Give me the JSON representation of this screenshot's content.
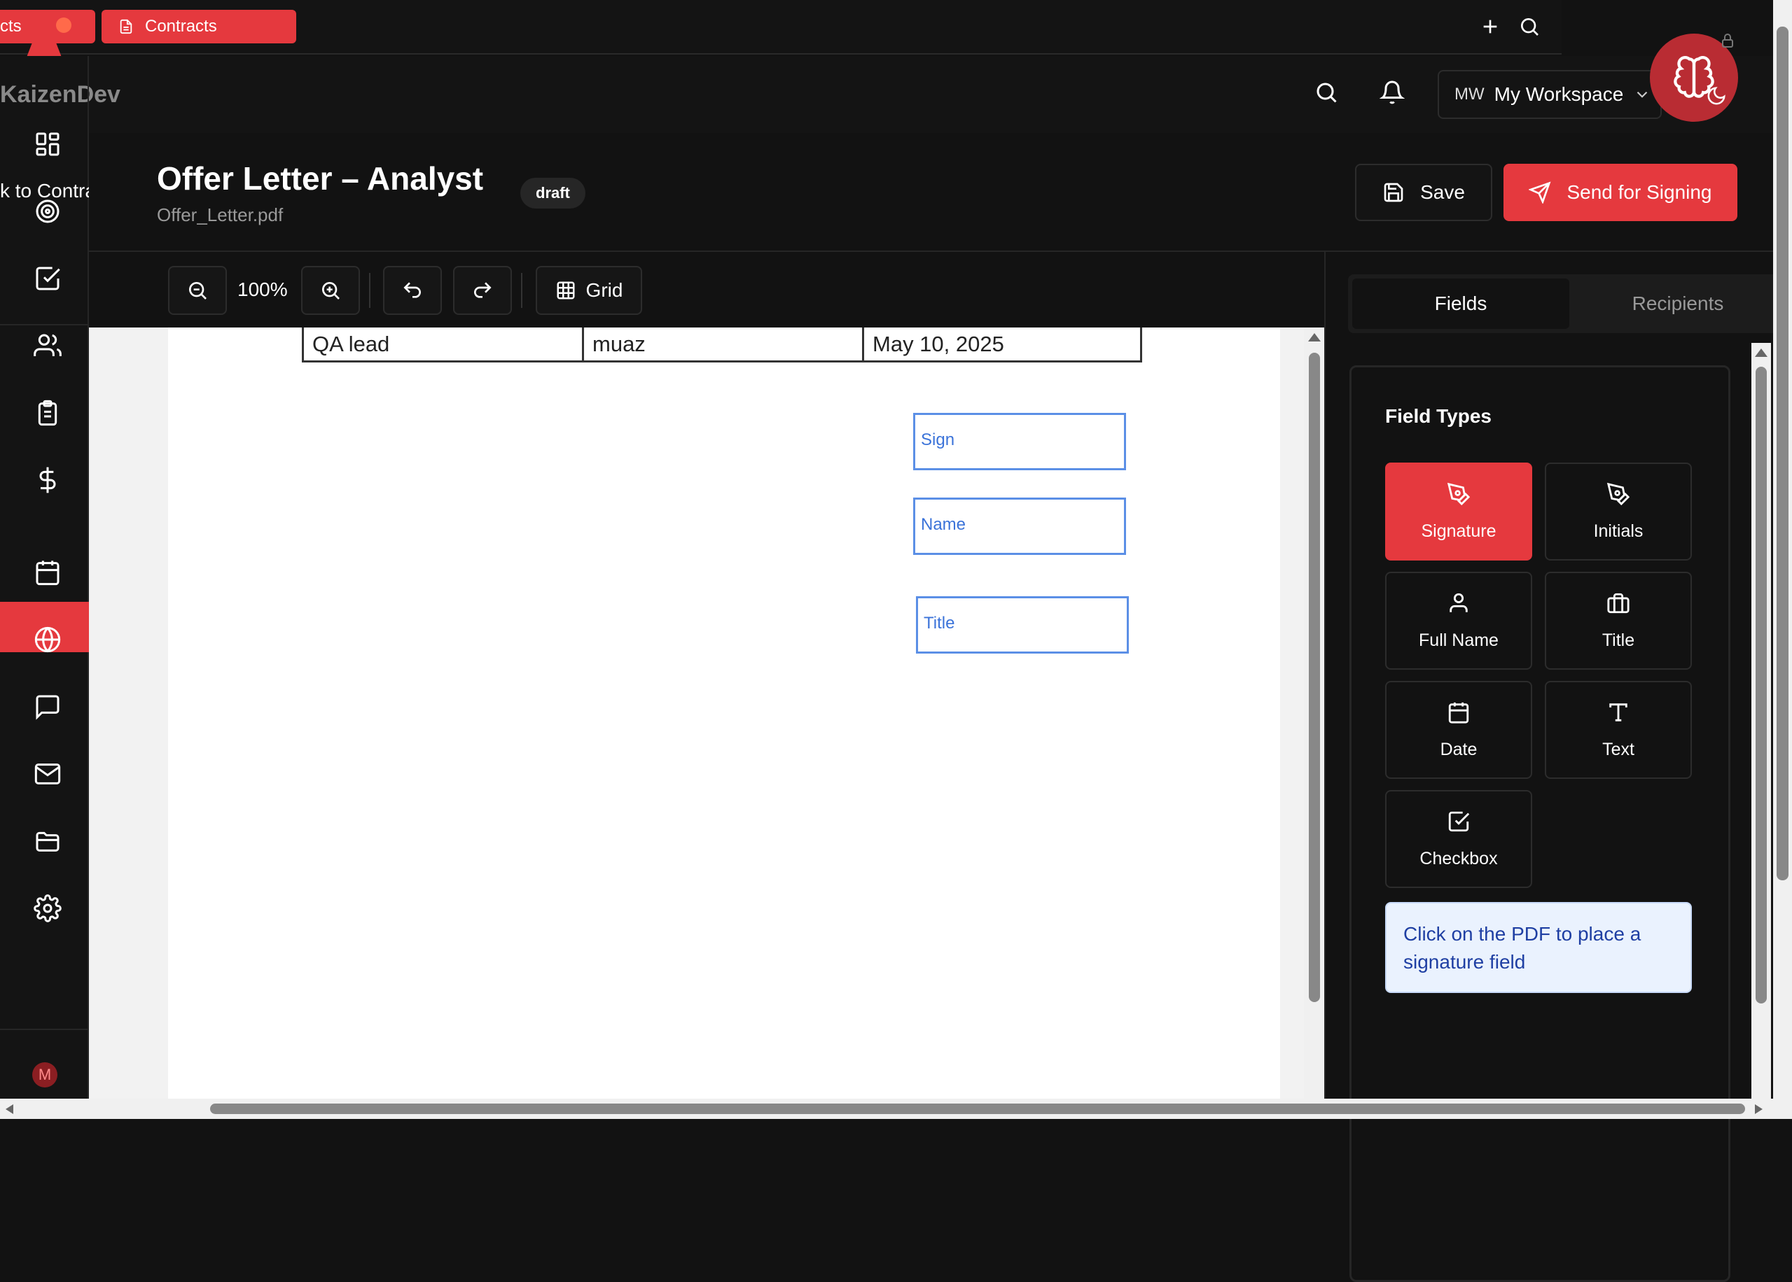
{
  "tabs": [
    {
      "label": "cts"
    },
    {
      "label": "Contracts"
    }
  ],
  "header": {
    "brand": "KaizenDev",
    "workspace_initials": "MW",
    "workspace_name": "My Workspace"
  },
  "sidebar": {
    "back_link": "k to Contracts",
    "avatar_initial": "M",
    "items": [
      {
        "icon": "dashboard-icon"
      },
      {
        "icon": "target-icon"
      },
      {
        "icon": "checkbox-icon"
      },
      {
        "icon": "users-icon"
      },
      {
        "icon": "clipboard-icon"
      },
      {
        "icon": "dollar-icon"
      },
      {
        "icon": "calendar-icon"
      },
      {
        "icon": "globe-icon"
      },
      {
        "icon": "chat-icon"
      },
      {
        "icon": "mail-icon"
      },
      {
        "icon": "folder-icon"
      },
      {
        "icon": "gear-icon"
      }
    ]
  },
  "document": {
    "title": "Offer Letter – Analyst",
    "status": "draft",
    "filename": "Offer_Letter.pdf",
    "save_label": "Save",
    "send_label": "Send for Signing"
  },
  "toolbar": {
    "zoom": "100%",
    "grid_label": "Grid"
  },
  "pdf": {
    "table_row": [
      "QA lead",
      "muaz",
      "May 10, 2025"
    ],
    "fields": [
      {
        "label": "Sign"
      },
      {
        "label": "Name"
      },
      {
        "label": "Title"
      }
    ]
  },
  "panel": {
    "tabs": [
      "Fields",
      "Recipients"
    ],
    "section_title": "Field Types",
    "field_types": [
      {
        "label": "Signature",
        "icon": "pen-icon"
      },
      {
        "label": "Initials",
        "icon": "pen-icon"
      },
      {
        "label": "Full Name",
        "icon": "user-icon"
      },
      {
        "label": "Title",
        "icon": "briefcase-icon"
      },
      {
        "label": "Date",
        "icon": "calendar-icon"
      },
      {
        "label": "Text",
        "icon": "text-icon"
      },
      {
        "label": "Checkbox",
        "icon": "checkbox-icon"
      }
    ],
    "hint": "Click on the PDF to place a signature field"
  },
  "colors": {
    "accent": "#e5393e",
    "background": "#121212",
    "field_blue": "#5b8fe6"
  }
}
